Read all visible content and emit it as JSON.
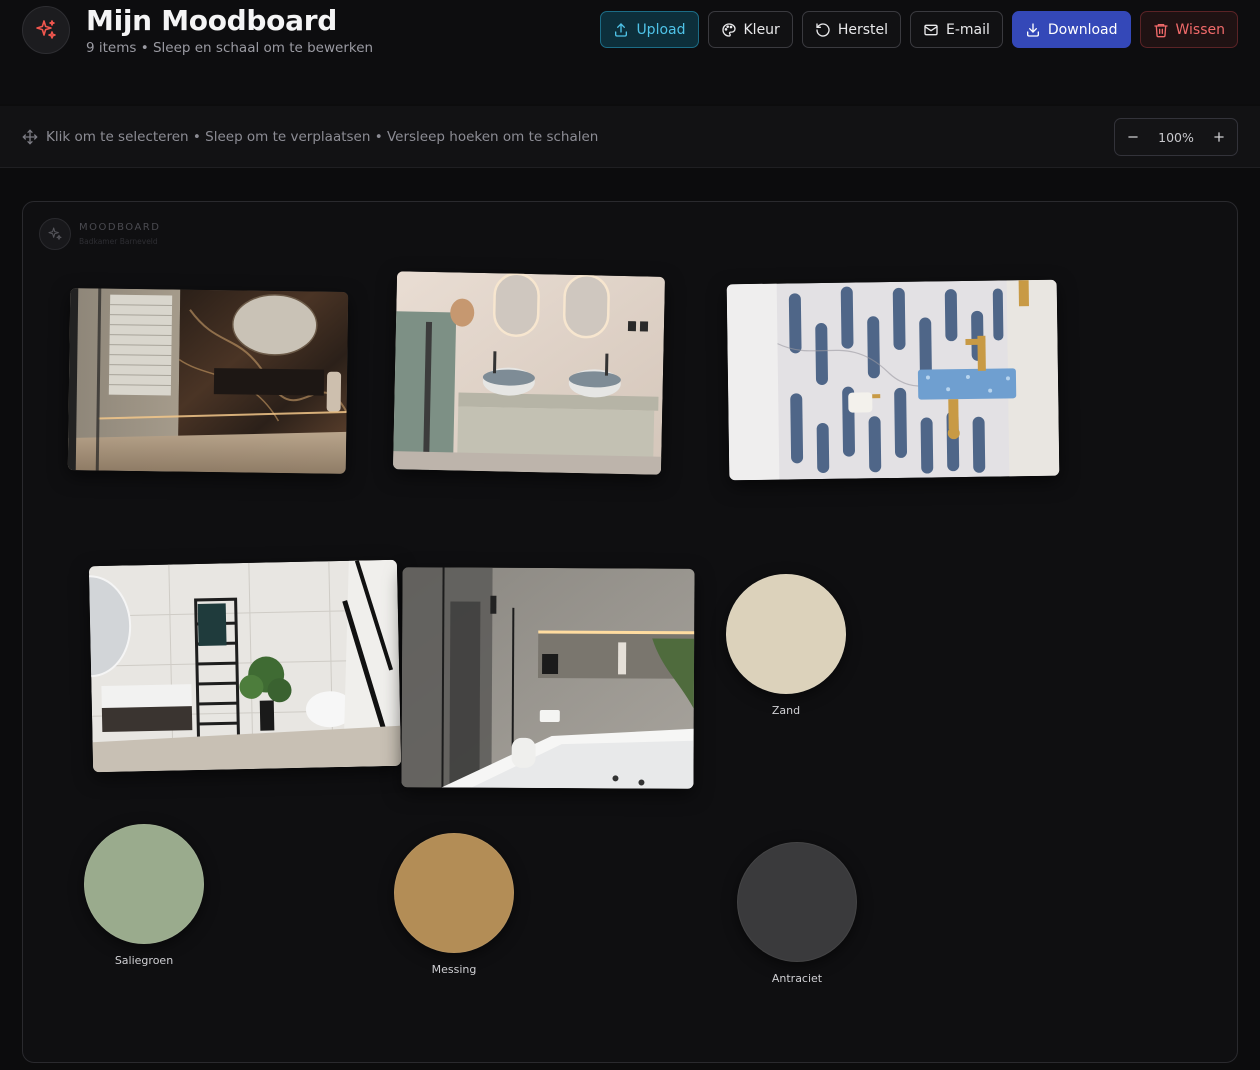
{
  "header": {
    "title": "Mijn Moodboard",
    "subtitle": "9 items • Sleep en schaal om te bewerken",
    "logo_icon": "sparkles-icon"
  },
  "toolbar": {
    "upload_label": "Upload",
    "color_label": "Kleur",
    "reset_label": "Herstel",
    "email_label": "E-mail",
    "download_label": "Download",
    "clear_label": "Wissen"
  },
  "hint": {
    "text": "Klik om te selecteren • Sleep om te verplaatsen • Versleep hoeken om te schalen",
    "icon": "move-icon"
  },
  "zoom": {
    "value": "100%"
  },
  "canvas": {
    "watermark_title": "MOODBOARD",
    "watermark_subtitle": "Badkamer Barneveld"
  },
  "swatches": [
    {
      "name": "Zand",
      "color": "#dcd2bb"
    },
    {
      "name": "Saliegroen",
      "color": "#9aab8d"
    },
    {
      "name": "Messing",
      "color": "#b38d56"
    },
    {
      "name": "Antraciet",
      "color": "#3a3a3c"
    }
  ],
  "colors": {
    "accent_upload": "#4fc3e8",
    "accent_download": "#3448b8",
    "accent_danger": "#f06a6a",
    "logo_icon": "#f0564e"
  }
}
